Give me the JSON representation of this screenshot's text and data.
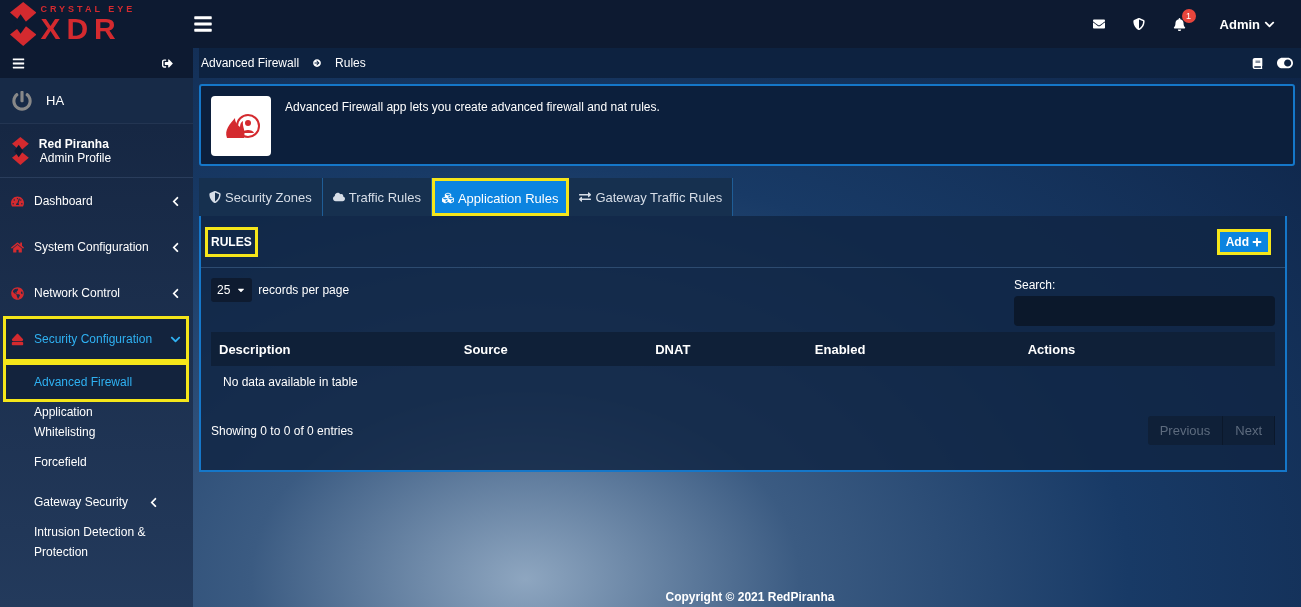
{
  "header": {
    "brand_top": "CRYSTAL EYE",
    "brand_main": "XDR",
    "notification_count": "1",
    "user": "Admin"
  },
  "sidebar": {
    "ha_label": "HA",
    "profile": {
      "name": "Red Piranha",
      "role": "Admin Profile"
    },
    "nav": [
      {
        "label": "Dashboard",
        "selected": false,
        "expanded": false,
        "highlighted": false
      },
      {
        "label": "System Configuration",
        "selected": false,
        "expanded": false,
        "highlighted": false
      },
      {
        "label": "Network Control",
        "selected": false,
        "expanded": false,
        "highlighted": false
      },
      {
        "label": "Security Configuration",
        "selected": true,
        "expanded": true,
        "highlighted": true,
        "children": [
          {
            "label": "Advanced Firewall",
            "selected": true,
            "highlighted": true,
            "has_submenu": false
          },
          {
            "label": "Application Whitelisting",
            "selected": false,
            "highlighted": false,
            "has_submenu": false
          },
          {
            "label": "Forcefield",
            "selected": false,
            "highlighted": false,
            "has_submenu": false
          },
          {
            "label": "Gateway Security",
            "selected": false,
            "highlighted": false,
            "has_submenu": true
          },
          {
            "label": "Intrusion Detection & Protection",
            "selected": false,
            "highlighted": false,
            "has_submenu": false
          }
        ]
      }
    ]
  },
  "breadcrumb": [
    "Advanced Firewall",
    "Rules"
  ],
  "app_info": {
    "description": "Advanced Firewall app lets you create advanced firewall and nat rules."
  },
  "tabs": [
    {
      "label": "Security Zones",
      "selected": false,
      "highlighted": false
    },
    {
      "label": "Traffic Rules",
      "selected": false,
      "highlighted": false
    },
    {
      "label": "Application Rules",
      "selected": true,
      "highlighted": true
    },
    {
      "label": "Gateway Traffic Rules",
      "selected": false,
      "highlighted": false
    }
  ],
  "panel": {
    "title": "RULES",
    "title_highlighted": true,
    "add_button": "Add",
    "add_highlighted": true,
    "page_size": "25",
    "page_size_label": "records per page",
    "search_label": "Search:",
    "table": {
      "columns": [
        "Description",
        "Source",
        "DNAT",
        "Enabled",
        "Actions"
      ],
      "empty_message": "No data available in table"
    },
    "info": "Showing 0 to 0 of 0 entries",
    "pager": [
      {
        "label": "Previous",
        "disabled": true
      },
      {
        "label": "Next",
        "disabled": true
      }
    ]
  },
  "footer": "Copyright © 2021 RedPiranha"
}
